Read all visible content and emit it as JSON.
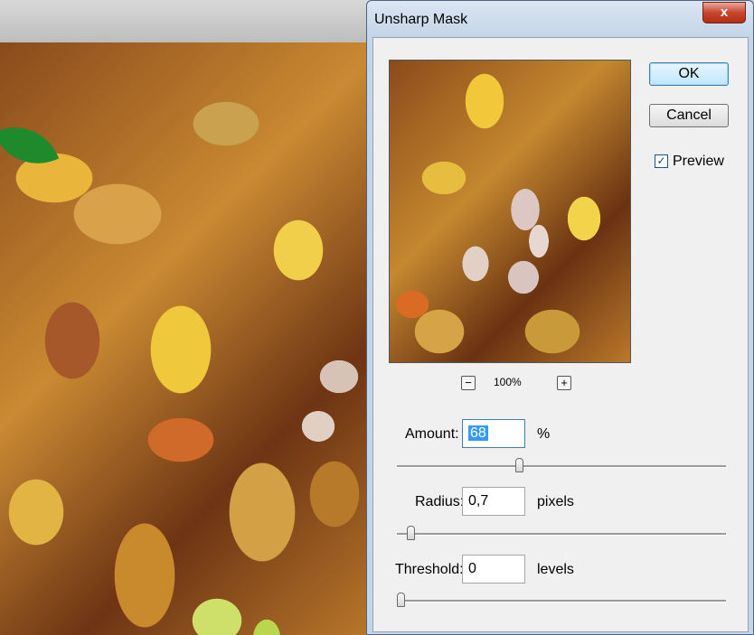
{
  "dialog": {
    "title": "Unsharp Mask",
    "close_glyph": "x",
    "ok_label": "OK",
    "cancel_label": "Cancel",
    "preview_label": "Preview",
    "preview_checked": true,
    "preview_check_glyph": "✓",
    "zoom": {
      "level": "100%",
      "zoom_out_glyph": "−",
      "zoom_in_glyph": "+"
    },
    "params": {
      "amount": {
        "label": "Amount:",
        "value": "68",
        "unit": "%",
        "slider_fraction": 0.37
      },
      "radius": {
        "label": "Radius:",
        "value": "0,7",
        "unit": "pixels",
        "slider_fraction": 0.03
      },
      "threshold": {
        "label": "Threshold:",
        "value": "0",
        "unit": "levels",
        "slider_fraction": 0.0
      }
    }
  },
  "colors": {
    "title_bar": "#c4d4e7",
    "close_button": "#c8452e",
    "selection": "#3399ff"
  }
}
